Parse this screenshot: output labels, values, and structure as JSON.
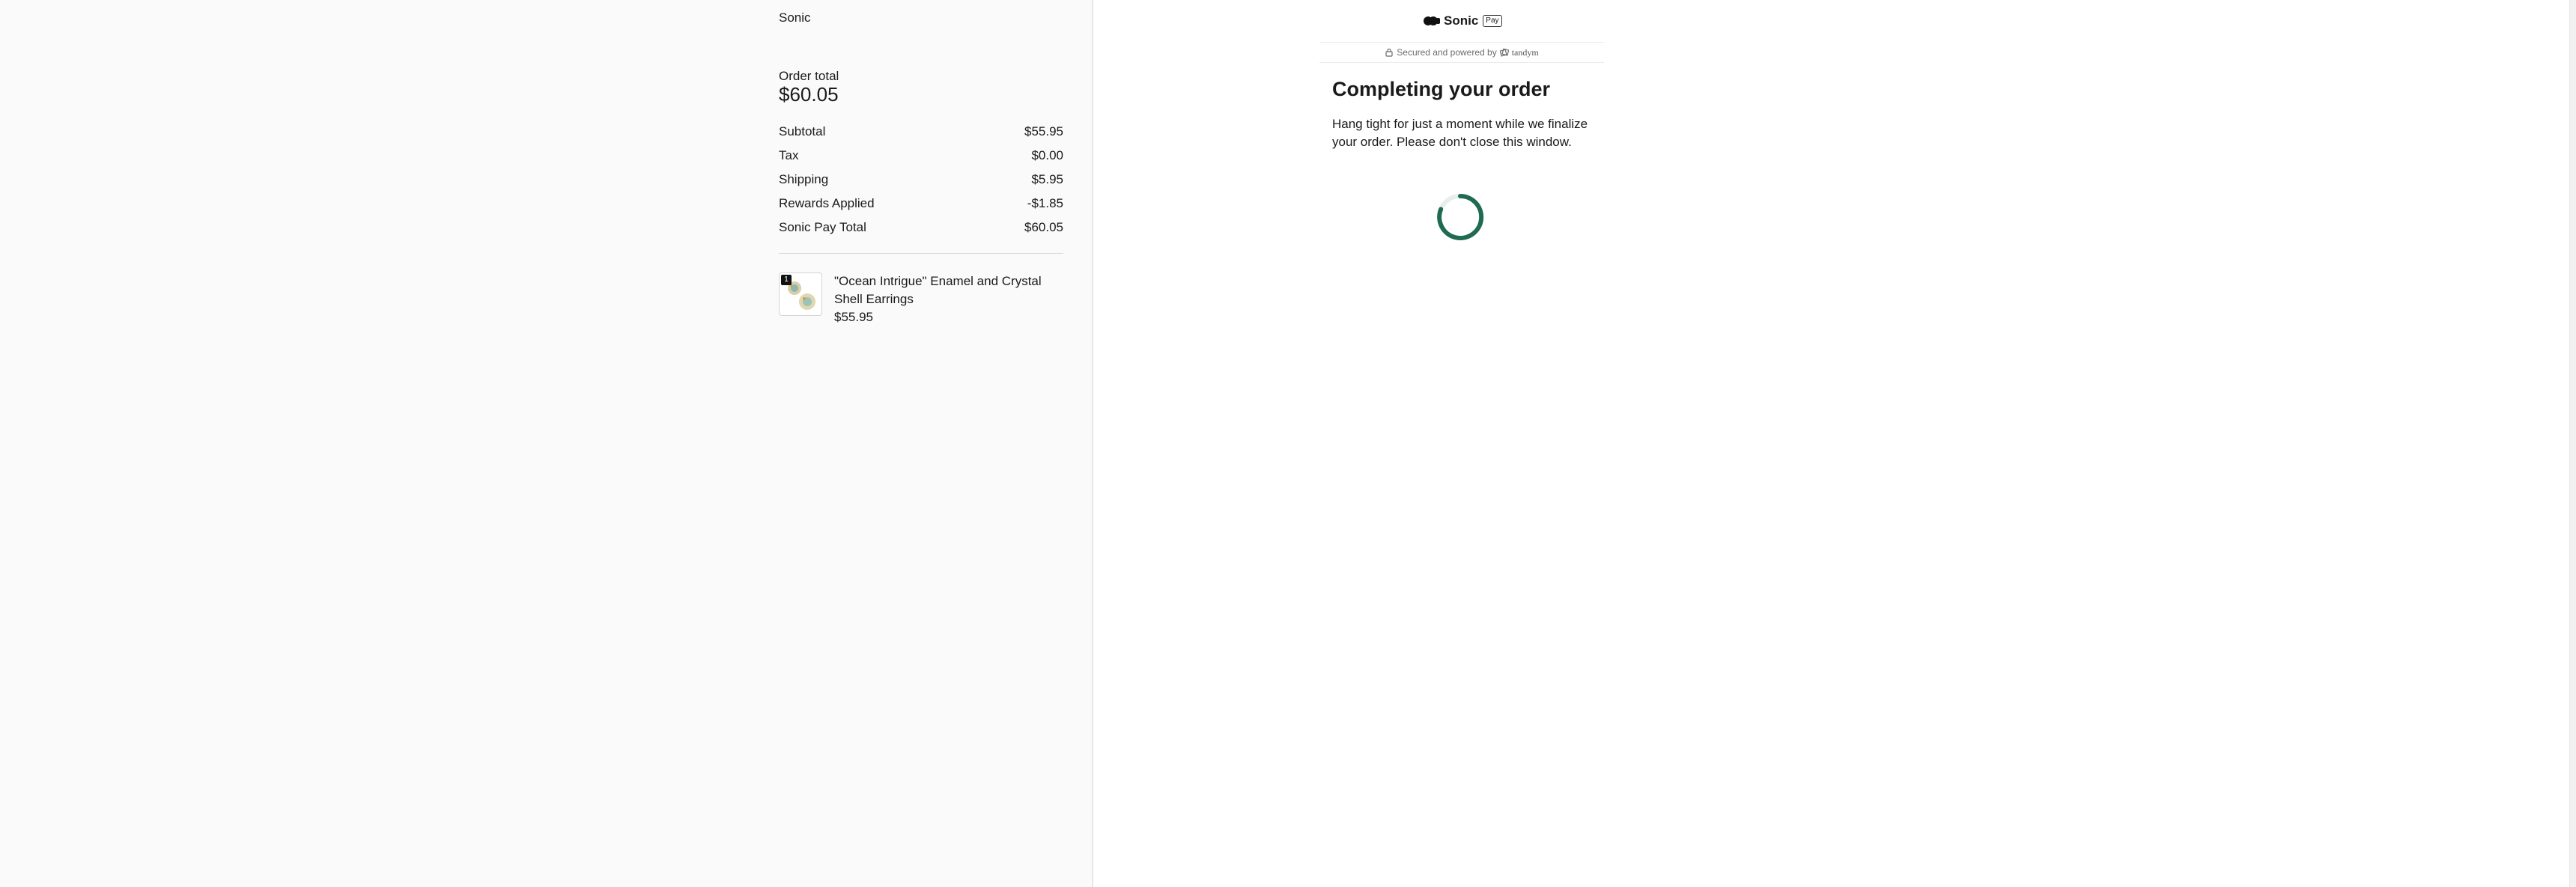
{
  "summary": {
    "merchant": "Sonic",
    "order_total_label": "Order total",
    "order_total_value": "$60.05",
    "rows": [
      {
        "label": "Subtotal",
        "value": "$55.95"
      },
      {
        "label": "Tax",
        "value": "$0.00"
      },
      {
        "label": "Shipping",
        "value": "$5.95"
      },
      {
        "label": "Rewards Applied",
        "value": "-$1.85"
      },
      {
        "label": "Sonic Pay Total",
        "value": "$60.05"
      }
    ],
    "product": {
      "quantity": "1",
      "name": "\"Ocean Intrigue\" Enamel and Crystal Shell Earrings",
      "price": "$55.95"
    }
  },
  "checkout": {
    "brand": "Sonic",
    "pay_badge": "Pay",
    "secured_text": "Secured and powered by",
    "provider": "tandym",
    "heading": "Completing your order",
    "message": "Hang tight for just a moment while we finalize your order. Please don't close this window.",
    "accent_color": "#1f6b52"
  }
}
